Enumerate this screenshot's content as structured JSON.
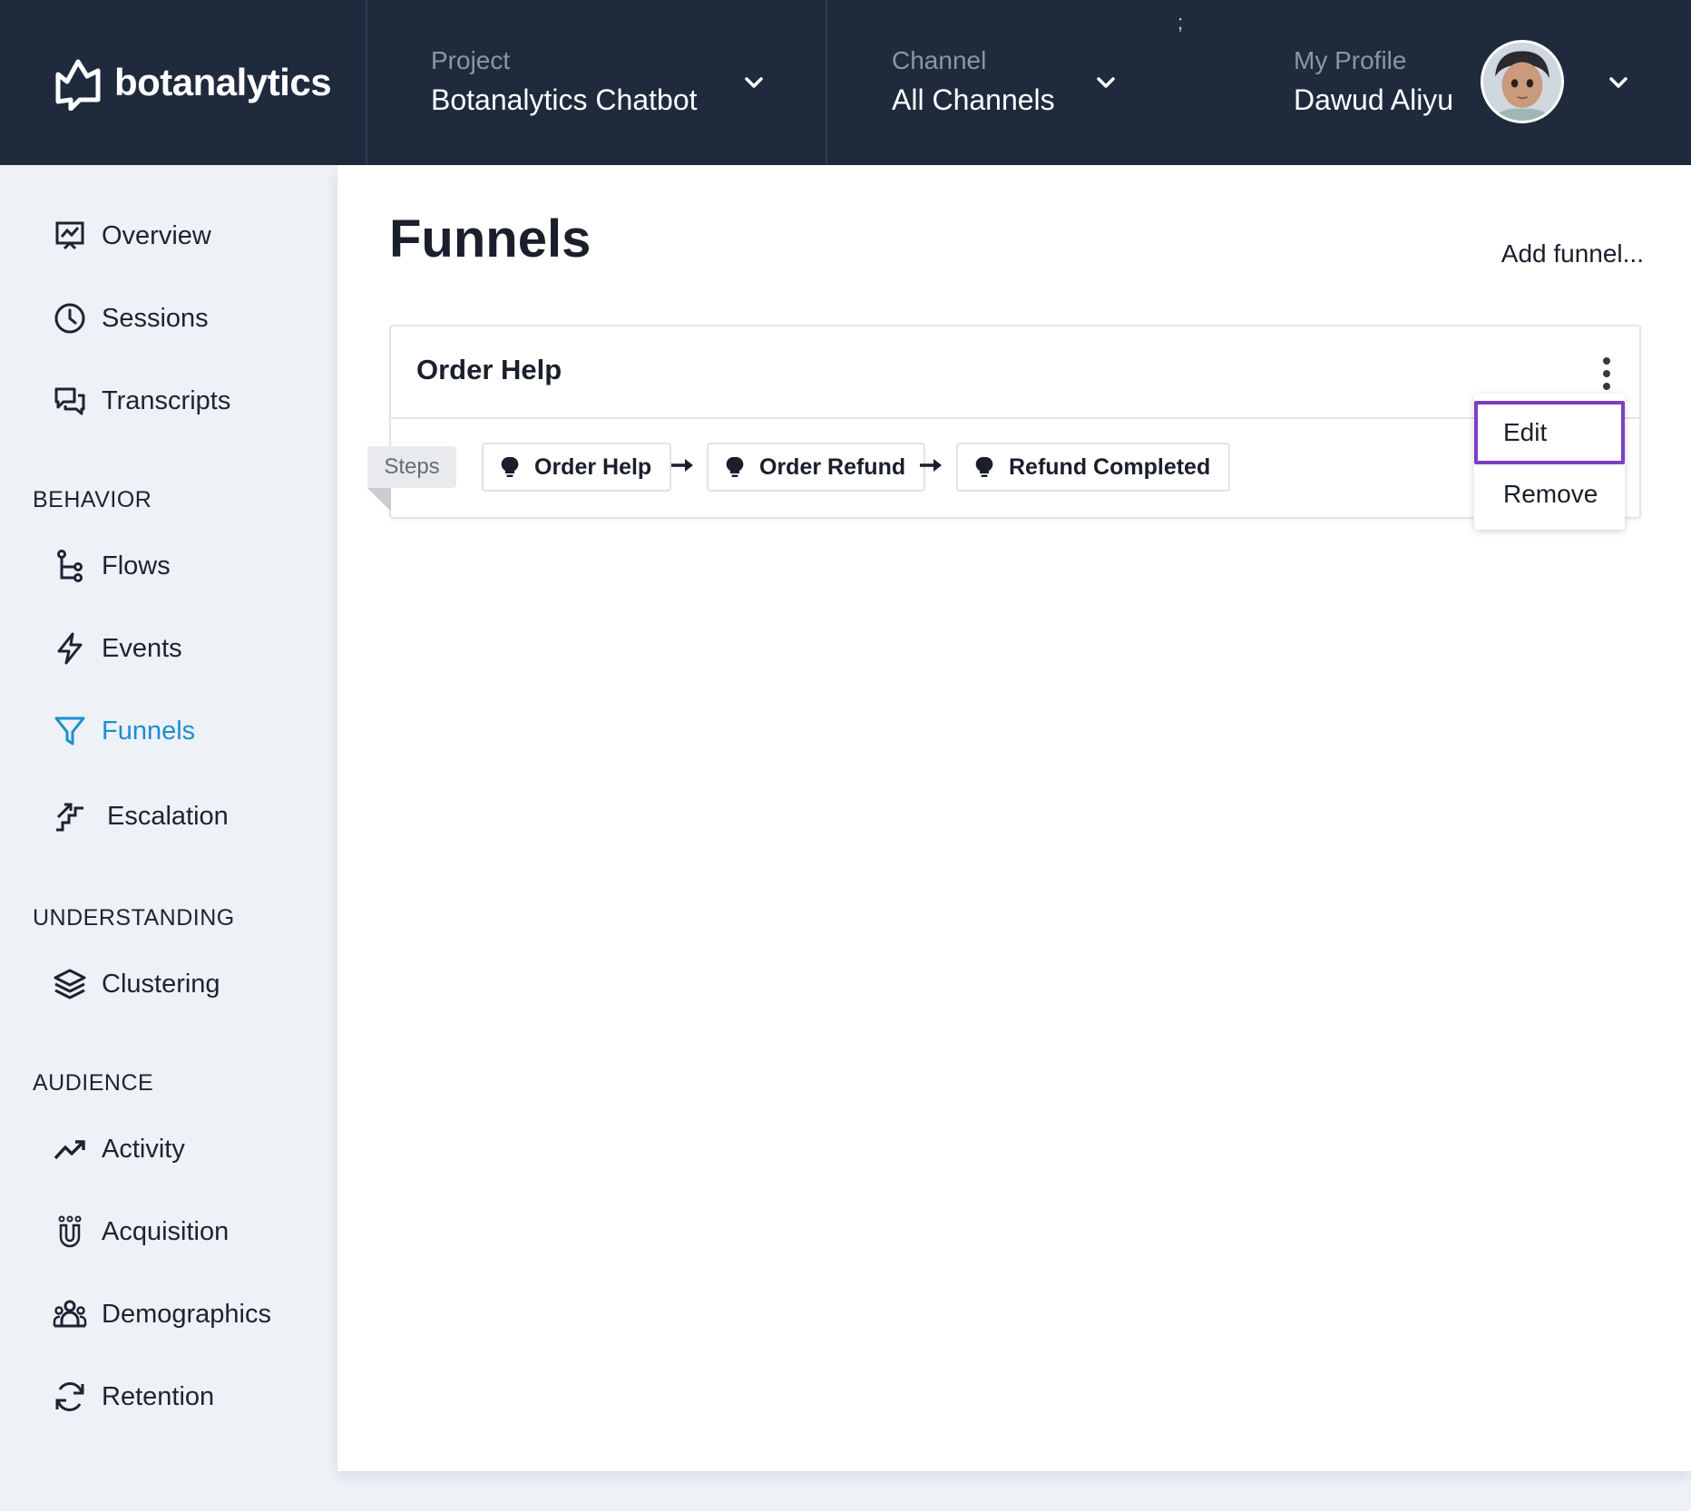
{
  "brand": {
    "name": "botanalytics"
  },
  "header": {
    "project": {
      "label": "Project",
      "value": "Botanalytics Chatbot"
    },
    "channel": {
      "label": "Channel",
      "value": "All Channels"
    },
    "profile": {
      "label": "My Profile",
      "value": "Dawud Aliyu"
    },
    "stray_mark": ";"
  },
  "sidebar": {
    "items_top": [
      {
        "label": "Overview",
        "icon": "presentation-chart-icon"
      },
      {
        "label": "Sessions",
        "icon": "clock-icon"
      },
      {
        "label": "Transcripts",
        "icon": "chat-bubbles-icon"
      }
    ],
    "behavior": {
      "heading": "BEHAVIOR",
      "items": [
        {
          "label": "Flows",
          "icon": "flow-branch-icon"
        },
        {
          "label": "Events",
          "icon": "lightning-icon"
        },
        {
          "label": "Funnels",
          "icon": "funnel-icon",
          "active": true
        },
        {
          "label": "Escalation",
          "icon": "stairs-arrow-icon"
        }
      ]
    },
    "understanding": {
      "heading": "UNDERSTANDING",
      "items": [
        {
          "label": "Clustering",
          "icon": "layers-icon"
        }
      ]
    },
    "audience": {
      "heading": "AUDIENCE",
      "items": [
        {
          "label": "Activity",
          "icon": "trend-up-icon"
        },
        {
          "label": "Acquisition",
          "icon": "magnet-users-icon"
        },
        {
          "label": "Demographics",
          "icon": "users-group-icon"
        },
        {
          "label": "Retention",
          "icon": "refresh-icon"
        }
      ]
    },
    "active_color": "#1a8fd1"
  },
  "main": {
    "title": "Funnels",
    "add_funnel": "Add funnel...",
    "funnel": {
      "name": "Order Help",
      "steps_label": "Steps",
      "steps": [
        "Order Help",
        "Order Refund",
        "Refund Completed"
      ]
    },
    "menu": {
      "items": [
        "Edit",
        "Remove"
      ],
      "highlighted": "Edit",
      "highlight_color": "#7b3fc6"
    }
  },
  "colors": {
    "topbar": "#1f2a3d",
    "sidebar": "#eef1f6"
  }
}
